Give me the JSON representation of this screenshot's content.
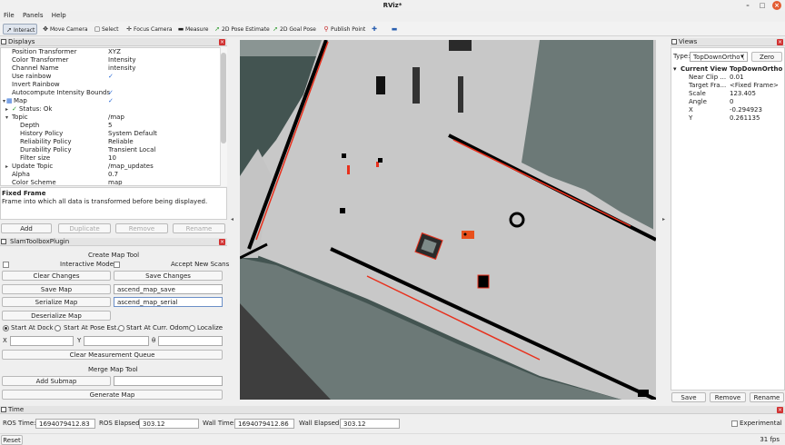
{
  "window": {
    "title": "RViz*"
  },
  "menu": [
    "File",
    "Panels",
    "Help"
  ],
  "toolbar": [
    {
      "label": "Interact",
      "icon": "interact-icon"
    },
    {
      "label": "Move Camera",
      "icon": "move-camera-icon"
    },
    {
      "label": "Select",
      "icon": "select-icon"
    },
    {
      "label": "Focus Camera",
      "icon": "focus-camera-icon"
    },
    {
      "label": "Measure",
      "icon": "measure-icon"
    },
    {
      "label": "2D Pose Estimate",
      "icon": "pose-estimate-icon"
    },
    {
      "label": "2D Goal Pose",
      "icon": "goal-pose-icon"
    },
    {
      "label": "Publish Point",
      "icon": "publish-point-icon"
    }
  ],
  "displays": {
    "title": "Displays",
    "rows": [
      {
        "key": "Position Transformer",
        "value": "XYZ"
      },
      {
        "key": "Color Transformer",
        "value": "Intensity"
      },
      {
        "key": "Channel Name",
        "value": "intensity"
      },
      {
        "key": "Use rainbow",
        "value": "✓"
      },
      {
        "key": "Invert Rainbow",
        "value": ""
      },
      {
        "key": "Autocompute Intensity Bounds",
        "value": "✓"
      },
      {
        "key": "Map",
        "value": "✓"
      },
      {
        "key": "Status: Ok",
        "value": ""
      },
      {
        "key": "Topic",
        "value": "/map"
      },
      {
        "key": "Depth",
        "value": "5"
      },
      {
        "key": "History Policy",
        "value": "System Default"
      },
      {
        "key": "Reliability Policy",
        "value": "Reliable"
      },
      {
        "key": "Durability Policy",
        "value": "Transient Local"
      },
      {
        "key": "Filter size",
        "value": "10"
      },
      {
        "key": "Update Topic",
        "value": "/map_updates"
      },
      {
        "key": "Alpha",
        "value": "0.7"
      },
      {
        "key": "Color Scheme",
        "value": "map"
      }
    ],
    "desc_title": "Fixed Frame",
    "desc_text": "Frame into which all data is transformed before being displayed.",
    "buttons": {
      "add": "Add",
      "duplicate": "Duplicate",
      "remove": "Remove",
      "rename": "Rename"
    }
  },
  "slam": {
    "title": "SlamToolboxPlugin",
    "create_title": "Create Map Tool",
    "interactive_mode": "Interactive Mode",
    "accept_new_scans": "Accept New Scans",
    "clear_changes": "Clear Changes",
    "save_changes": "Save Changes",
    "save_map": "Save Map",
    "save_map_value": "ascend_map_save",
    "serialize_map": "Serialize Map",
    "serialize_map_value": "ascend_map_serial",
    "deserialize_map": "Deserialize Map",
    "start_at_dock": "Start At Dock",
    "start_at_pose_est": "Start At Pose Est.",
    "start_at_curr_odom": "Start At Curr. Odom",
    "localize": "Localize",
    "x_label": "X",
    "y_label": "Y",
    "theta_label": "θ",
    "clear_measurement_queue": "Clear Measurement Queue",
    "merge_title": "Merge Map Tool",
    "add_submap": "Add Submap",
    "generate_map": "Generate Map"
  },
  "views": {
    "title": "Views",
    "type_label": "Type:",
    "type_value": "TopDownOrtho (",
    "zero": "Zero",
    "current_view_key": "Current View",
    "current_view_value": "TopDownOrtho",
    "props": [
      {
        "key": "Near Clip ...",
        "value": "0.01"
      },
      {
        "key": "Target Fra...",
        "value": "<Fixed Frame>"
      },
      {
        "key": "Scale",
        "value": "123.405"
      },
      {
        "key": "Angle",
        "value": "0"
      },
      {
        "key": "X",
        "value": "-0.294923"
      },
      {
        "key": "Y",
        "value": "0.261135"
      }
    ],
    "save": "Save",
    "remove": "Remove",
    "rename": "Rename"
  },
  "time": {
    "title": "Time",
    "ros_time_label": "ROS Time:",
    "ros_time": "1694079412.83",
    "ros_elapsed_label": "ROS Elapsed:",
    "ros_elapsed": "303.12",
    "wall_time_label": "Wall Time:",
    "wall_time": "1694079412.86",
    "wall_elapsed_label": "Wall Elapsed:",
    "wall_elapsed": "303.12",
    "experimental": "Experimental"
  },
  "status": {
    "reset": "Reset",
    "fps": "31 fps"
  },
  "colors": {
    "occupied": "#000000",
    "free": "#c8c8c8",
    "unknown": "#435451",
    "laser": "#e8301c"
  }
}
